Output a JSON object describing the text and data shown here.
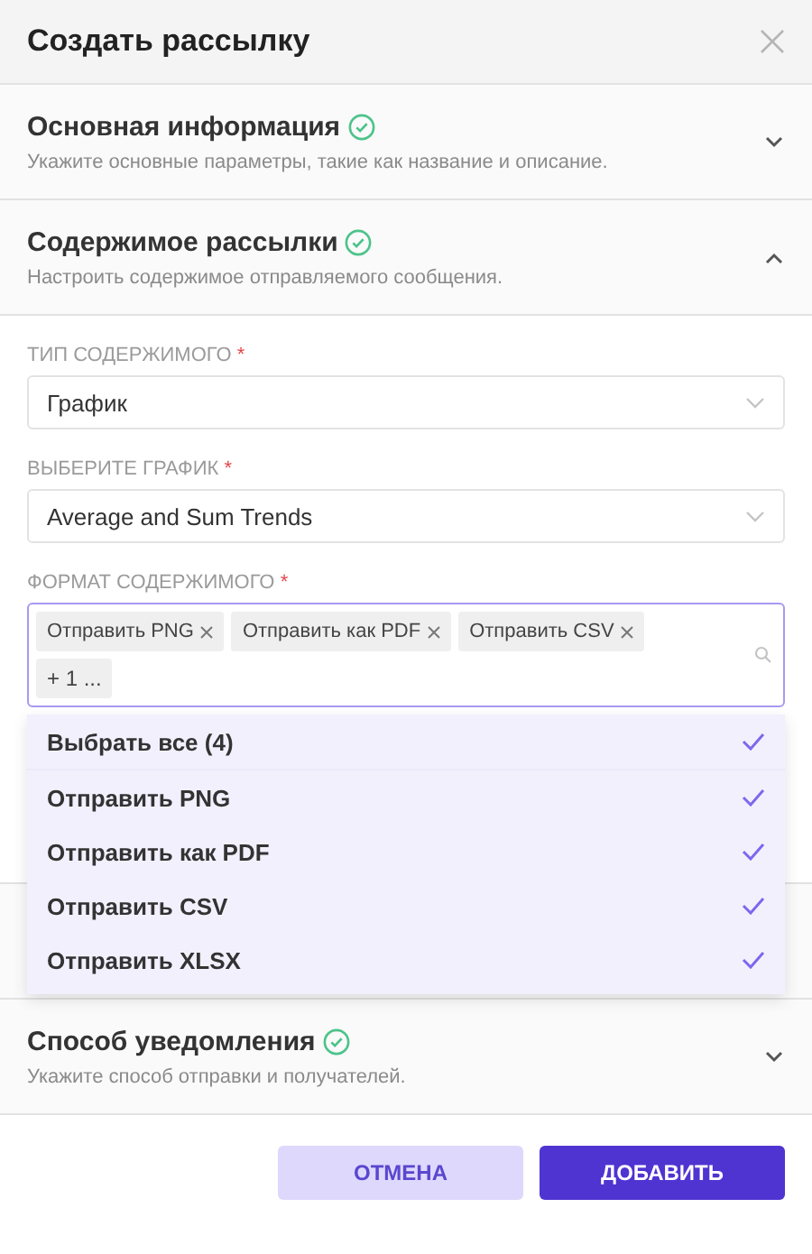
{
  "dialog": {
    "title": "Создать рассылку"
  },
  "sections": [
    {
      "title": "Основная информация",
      "subtitle": "Укажите основные параметры, такие как название и описание.",
      "complete": true,
      "expanded": false
    },
    {
      "title": "Содержимое рассылки",
      "subtitle": "Настроить содержимое отправляемого сообщения.",
      "complete": true,
      "expanded": true,
      "fields": [
        {
          "kind": "select",
          "label": "ТИП СОДЕРЖИМОГО",
          "mark": "*",
          "value": "График"
        },
        {
          "kind": "select",
          "label": "ВЫБЕРИТЕ ГРАФИК",
          "mark": "*",
          "value": "Average and Sum Trends"
        },
        {
          "kind": "multiselect",
          "label": "ФОРМАТ СОДЕРЖИМОГО",
          "mark": "*",
          "focused": true,
          "tags": [
            "Отправить PNG",
            "Отправить как PDF",
            "Отправить CSV"
          ],
          "more": "+ 1 ...",
          "options": [
            {
              "label": "Выбрать все (4)",
              "checked": true
            },
            {
              "label": "Отправить PNG",
              "checked": true
            },
            {
              "label": "Отправить как PDF",
              "checked": true
            },
            {
              "label": "Отправить CSV",
              "checked": true
            },
            {
              "label": "Отправить XLSX",
              "checked": true
            }
          ]
        }
      ]
    },
    {
      "title": "Способ уведомления",
      "subtitle": "Укажите способ отправки и получателей.",
      "complete": true,
      "expanded": false
    }
  ],
  "buttons": [
    {
      "label": "ОТМЕНА",
      "kind": "secondary"
    },
    {
      "label": "ДОБАВИТЬ",
      "kind": "primary"
    }
  ]
}
